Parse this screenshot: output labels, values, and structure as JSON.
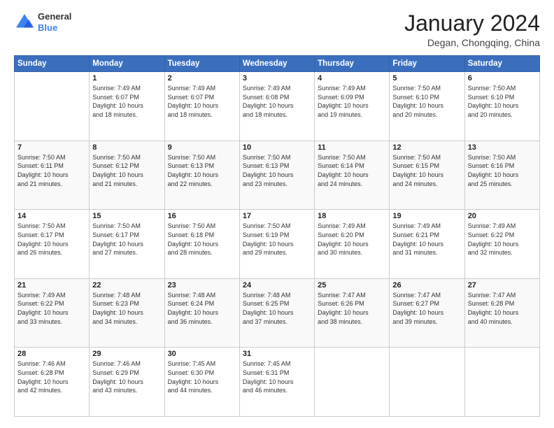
{
  "header": {
    "logo_general": "General",
    "logo_blue": "Blue",
    "month_year": "January 2024",
    "location": "Degan, Chongqing, China"
  },
  "days_of_week": [
    "Sunday",
    "Monday",
    "Tuesday",
    "Wednesday",
    "Thursday",
    "Friday",
    "Saturday"
  ],
  "weeks": [
    [
      {
        "num": "",
        "info": ""
      },
      {
        "num": "1",
        "info": "Sunrise: 7:49 AM\nSunset: 6:07 PM\nDaylight: 10 hours\nand 18 minutes."
      },
      {
        "num": "2",
        "info": "Sunrise: 7:49 AM\nSunset: 6:07 PM\nDaylight: 10 hours\nand 18 minutes."
      },
      {
        "num": "3",
        "info": "Sunrise: 7:49 AM\nSunset: 6:08 PM\nDaylight: 10 hours\nand 18 minutes."
      },
      {
        "num": "4",
        "info": "Sunrise: 7:49 AM\nSunset: 6:09 PM\nDaylight: 10 hours\nand 19 minutes."
      },
      {
        "num": "5",
        "info": "Sunrise: 7:50 AM\nSunset: 6:10 PM\nDaylight: 10 hours\nand 20 minutes."
      },
      {
        "num": "6",
        "info": "Sunrise: 7:50 AM\nSunset: 6:10 PM\nDaylight: 10 hours\nand 20 minutes."
      }
    ],
    [
      {
        "num": "7",
        "info": "Sunrise: 7:50 AM\nSunset: 6:11 PM\nDaylight: 10 hours\nand 21 minutes."
      },
      {
        "num": "8",
        "info": "Sunrise: 7:50 AM\nSunset: 6:12 PM\nDaylight: 10 hours\nand 21 minutes."
      },
      {
        "num": "9",
        "info": "Sunrise: 7:50 AM\nSunset: 6:13 PM\nDaylight: 10 hours\nand 22 minutes."
      },
      {
        "num": "10",
        "info": "Sunrise: 7:50 AM\nSunset: 6:13 PM\nDaylight: 10 hours\nand 23 minutes."
      },
      {
        "num": "11",
        "info": "Sunrise: 7:50 AM\nSunset: 6:14 PM\nDaylight: 10 hours\nand 24 minutes."
      },
      {
        "num": "12",
        "info": "Sunrise: 7:50 AM\nSunset: 6:15 PM\nDaylight: 10 hours\nand 24 minutes."
      },
      {
        "num": "13",
        "info": "Sunrise: 7:50 AM\nSunset: 6:16 PM\nDaylight: 10 hours\nand 25 minutes."
      }
    ],
    [
      {
        "num": "14",
        "info": "Sunrise: 7:50 AM\nSunset: 6:17 PM\nDaylight: 10 hours\nand 26 minutes."
      },
      {
        "num": "15",
        "info": "Sunrise: 7:50 AM\nSunset: 6:17 PM\nDaylight: 10 hours\nand 27 minutes."
      },
      {
        "num": "16",
        "info": "Sunrise: 7:50 AM\nSunset: 6:18 PM\nDaylight: 10 hours\nand 28 minutes."
      },
      {
        "num": "17",
        "info": "Sunrise: 7:50 AM\nSunset: 6:19 PM\nDaylight: 10 hours\nand 29 minutes."
      },
      {
        "num": "18",
        "info": "Sunrise: 7:49 AM\nSunset: 6:20 PM\nDaylight: 10 hours\nand 30 minutes."
      },
      {
        "num": "19",
        "info": "Sunrise: 7:49 AM\nSunset: 6:21 PM\nDaylight: 10 hours\nand 31 minutes."
      },
      {
        "num": "20",
        "info": "Sunrise: 7:49 AM\nSunset: 6:22 PM\nDaylight: 10 hours\nand 32 minutes."
      }
    ],
    [
      {
        "num": "21",
        "info": "Sunrise: 7:49 AM\nSunset: 6:22 PM\nDaylight: 10 hours\nand 33 minutes."
      },
      {
        "num": "22",
        "info": "Sunrise: 7:48 AM\nSunset: 6:23 PM\nDaylight: 10 hours\nand 34 minutes."
      },
      {
        "num": "23",
        "info": "Sunrise: 7:48 AM\nSunset: 6:24 PM\nDaylight: 10 hours\nand 36 minutes."
      },
      {
        "num": "24",
        "info": "Sunrise: 7:48 AM\nSunset: 6:25 PM\nDaylight: 10 hours\nand 37 minutes."
      },
      {
        "num": "25",
        "info": "Sunrise: 7:47 AM\nSunset: 6:26 PM\nDaylight: 10 hours\nand 38 minutes."
      },
      {
        "num": "26",
        "info": "Sunrise: 7:47 AM\nSunset: 6:27 PM\nDaylight: 10 hours\nand 39 minutes."
      },
      {
        "num": "27",
        "info": "Sunrise: 7:47 AM\nSunset: 6:28 PM\nDaylight: 10 hours\nand 40 minutes."
      }
    ],
    [
      {
        "num": "28",
        "info": "Sunrise: 7:46 AM\nSunset: 6:28 PM\nDaylight: 10 hours\nand 42 minutes."
      },
      {
        "num": "29",
        "info": "Sunrise: 7:46 AM\nSunset: 6:29 PM\nDaylight: 10 hours\nand 43 minutes."
      },
      {
        "num": "30",
        "info": "Sunrise: 7:45 AM\nSunset: 6:30 PM\nDaylight: 10 hours\nand 44 minutes."
      },
      {
        "num": "31",
        "info": "Sunrise: 7:45 AM\nSunset: 6:31 PM\nDaylight: 10 hours\nand 46 minutes."
      },
      {
        "num": "",
        "info": ""
      },
      {
        "num": "",
        "info": ""
      },
      {
        "num": "",
        "info": ""
      }
    ]
  ]
}
